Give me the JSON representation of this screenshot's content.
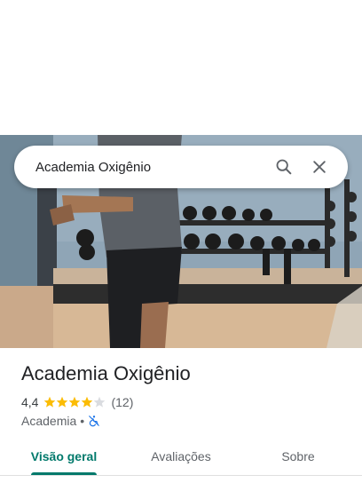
{
  "search": {
    "query": "Academia Oxigênio"
  },
  "place": {
    "name": "Academia Oxigênio",
    "rating": "4,4",
    "stars": 4.4,
    "review_count": "(12)",
    "category": "Academia",
    "separator": "•",
    "accessibility_icon": "not-wheelchair-accessible-icon"
  },
  "tabs": [
    {
      "label": "Visão geral",
      "active": true
    },
    {
      "label": "Avaliações",
      "active": false
    },
    {
      "label": "Sobre",
      "active": false
    }
  ],
  "colors": {
    "accent": "#00796b",
    "star": "#fbbc04",
    "accessibility_icon": "#1a73e8"
  }
}
